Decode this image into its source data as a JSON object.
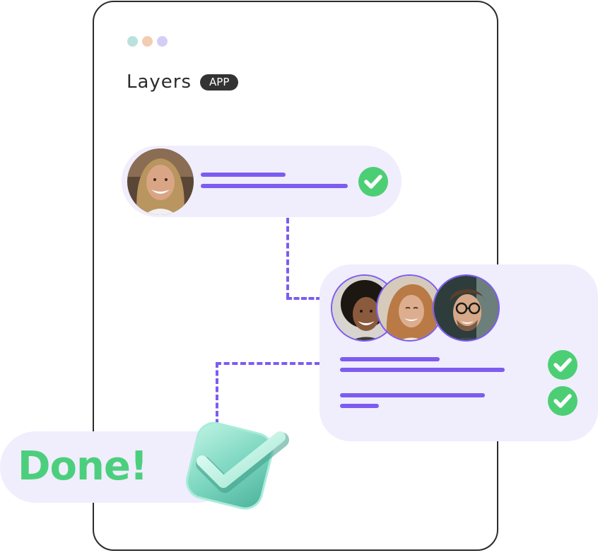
{
  "window": {
    "dots": [
      {
        "name": "teal-dot",
        "color": "#b9e2dd"
      },
      {
        "name": "peach-dot",
        "color": "#f2cdb1"
      },
      {
        "name": "lavender-dot",
        "color": "#d6cdf7"
      }
    ],
    "title": "Layers",
    "badge": "APP"
  },
  "colors": {
    "accent": "#7c5cf0",
    "card_bg": "#f0edfd",
    "success": "#4ccf74",
    "done_text": "#4ccf7d"
  },
  "task_card": {
    "avatar_icon": "person-avatar-woman",
    "status_icon": "check-circle-icon"
  },
  "team_card": {
    "avatars": [
      "person-avatar-curly-hair",
      "person-avatar-long-hair",
      "person-avatar-glasses"
    ],
    "status_icons": [
      "check-circle-icon",
      "check-circle-icon"
    ]
  },
  "done": {
    "label": "Done!",
    "icon": "3d-check-icon"
  }
}
